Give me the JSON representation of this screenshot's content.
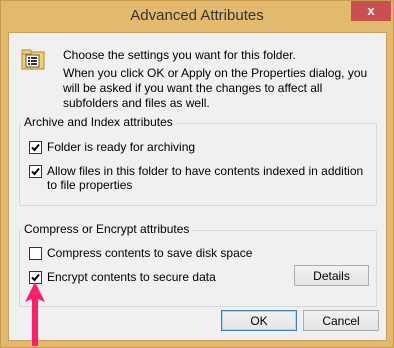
{
  "window": {
    "title": "Advanced Attributes",
    "close_label": "x"
  },
  "intro": {
    "line1": "Choose the settings you want for this folder.",
    "line2": "When you click OK or Apply on the Properties dialog, you will be asked if you want the changes to affect all subfolders and files as well."
  },
  "archive_group": {
    "title": "Archive and Index attributes",
    "items": [
      {
        "label": "Folder is ready for archiving",
        "checked": true
      },
      {
        "label": "Allow files in this folder to have contents indexed in addition to file properties",
        "checked": true
      }
    ]
  },
  "compress_group": {
    "title": "Compress or Encrypt attributes",
    "items": [
      {
        "label": "Compress contents to save disk space",
        "checked": false
      },
      {
        "label": "Encrypt contents to secure data",
        "checked": true
      }
    ],
    "details_label": "Details"
  },
  "buttons": {
    "ok": "OK",
    "cancel": "Cancel"
  },
  "colors": {
    "arrow": "#ff1f6b",
    "accent": "#3c7fb1"
  },
  "icons": {
    "folder": "folder-settings-icon",
    "close": "close-icon",
    "arrow": "arrow-up-icon"
  }
}
